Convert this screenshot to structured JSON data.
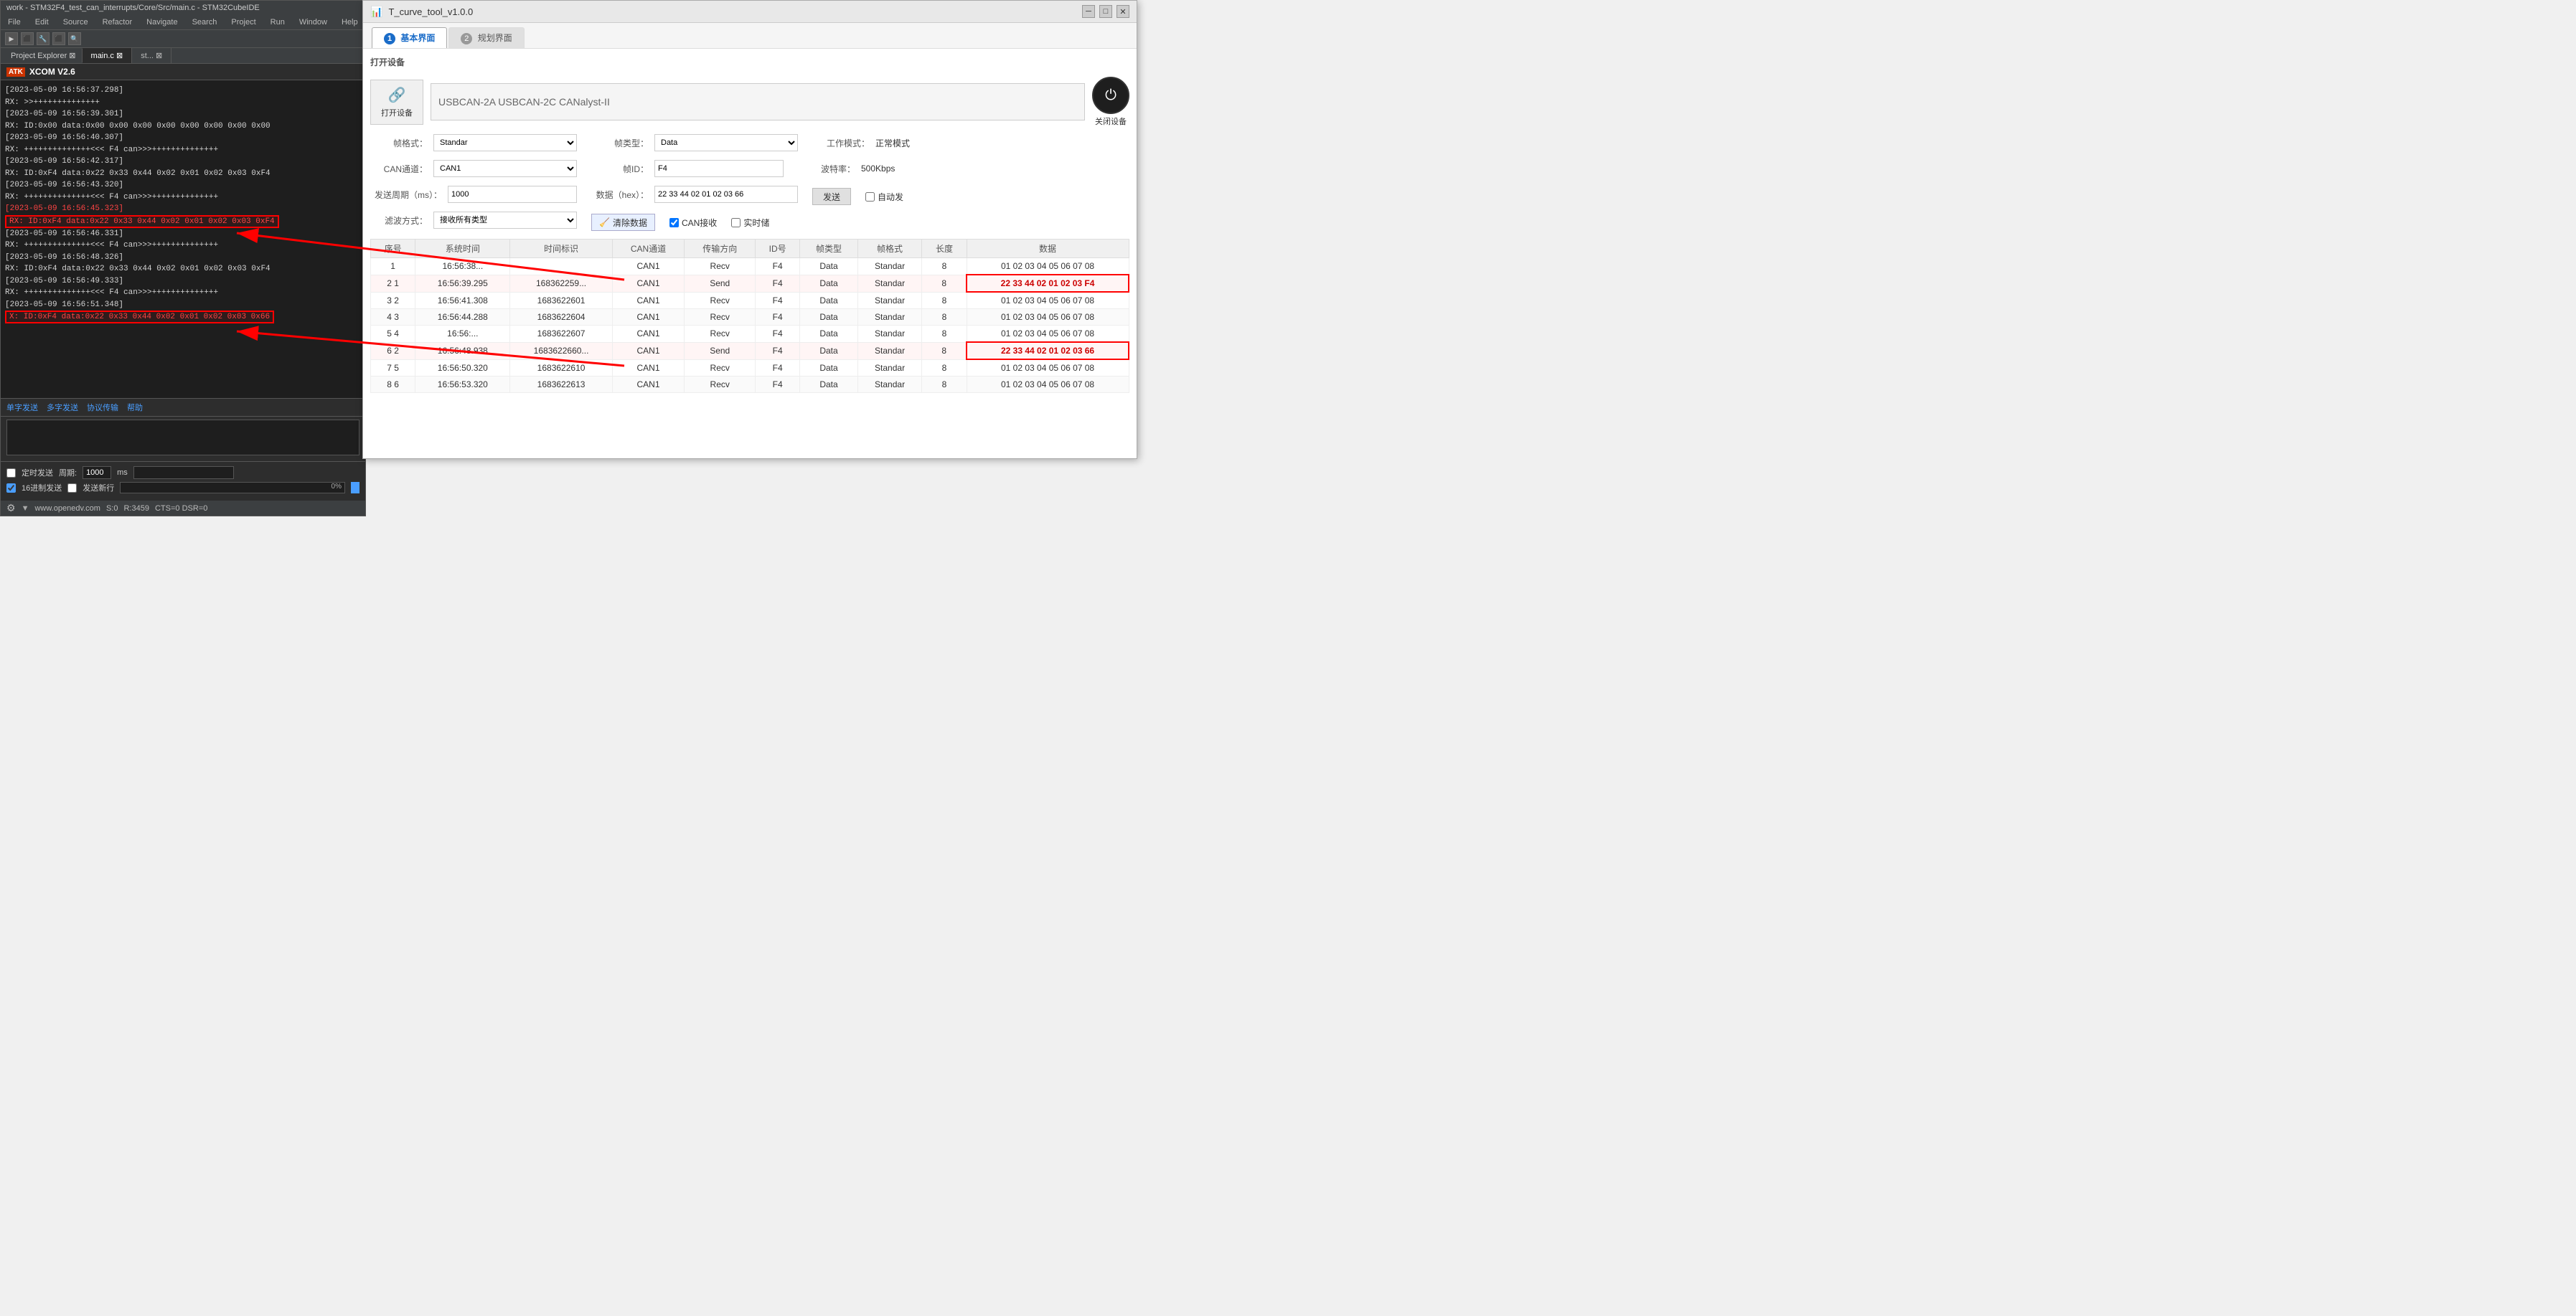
{
  "ide": {
    "title": "work - STM32F4_test_can_interrupts/Core/Src/main.c - STM32CubeIDE",
    "menu": [
      "File",
      "Edit",
      "Source",
      "Refactor",
      "Navigate",
      "Search",
      "Project",
      "Run",
      "Window",
      "Help"
    ],
    "tabs": [
      {
        "label": "main.c",
        "active": true
      },
      {
        "label": "st...",
        "active": false
      }
    ],
    "xcom": {
      "title": "XCOM V2.6",
      "logo": "ATK",
      "logs": [
        {
          "text": "[2023-05-09 16:56:37.298]",
          "type": "timestamp"
        },
        {
          "text": "RX: >>++++++++++++++",
          "type": "normal"
        },
        {
          "text": "[2023-05-09 16:56:39.301]",
          "type": "timestamp"
        },
        {
          "text": "RX: ID:0x00   data:0x00 0x00 0x00 0x00 0x00 0x00 0x00 0x00",
          "type": "normal"
        },
        {
          "text": "[2023-05-09 16:56:40.307]",
          "type": "timestamp"
        },
        {
          "text": "RX: ++++++++++++++<<< F4 can>>>++++++++++++++",
          "type": "normal"
        },
        {
          "text": "[2023-05-09 16:56:42.317]",
          "type": "timestamp"
        },
        {
          "text": "RX: ID:0xF4   data:0x22 0x33 0x44 0x02 0x01 0x02 0x03 0xF4",
          "type": "normal"
        },
        {
          "text": "[2023-05-09 16:56:43.320]",
          "type": "timestamp"
        },
        {
          "text": "RX: ++++++++++++++<<< F4 can>>>++++++++++++++",
          "type": "normal"
        },
        {
          "text": "[2023-05-09 16:56:45.323]",
          "type": "timestamp-red"
        },
        {
          "text": "RX: ID:0xF4   data:0x22 0x33 0x44 0x02 0x01 0x02 0x03 0xF4",
          "type": "highlight"
        },
        {
          "text": "[2023-05-09 16:56:46.331]",
          "type": "timestamp"
        },
        {
          "text": "RX: ++++++++++++++<<< F4 can>>>++++++++++++++",
          "type": "normal"
        },
        {
          "text": "[2023-05-09 16:56:48.326]",
          "type": "timestamp"
        },
        {
          "text": "RX: ID:0xF4   data:0x22 0x33 0x44 0x02 0x01 0x02 0x03 0xF4",
          "type": "normal"
        },
        {
          "text": "[2023-05-09 16:56:49.333]",
          "type": "timestamp"
        },
        {
          "text": "RX: ++++++++++++++<<< F4 can>>>++++++++++++++",
          "type": "normal"
        },
        {
          "text": "[2023-05-09 16:56:51.348]",
          "type": "timestamp"
        },
        {
          "text": "X: ID:0xF4   data:0x22 0x33 0x44 0x02 0x01 0x02 0x03 0x66",
          "type": "highlight2"
        }
      ],
      "bottom_menus": [
        "单字发送",
        "多字发送",
        "协议传输",
        "帮助"
      ],
      "timed_send_label": "定时发送",
      "period_label": "周期:",
      "period_value": "1000",
      "period_unit": "ms",
      "hex_label": "16进制发送",
      "newline_label": "发送新行",
      "progress": "0%",
      "statusbar": {
        "url": "www.openedv.com",
        "s": "S:0",
        "r": "R:3459",
        "cts_dsr": "CTS=0 DSR=0"
      }
    }
  },
  "tcurve": {
    "title": "T_curve_tool_v1.0.0",
    "tabs": [
      {
        "num": "1",
        "label": "基本界面",
        "active": true
      },
      {
        "num": "2",
        "label": "规划界面",
        "active": false
      }
    ],
    "connect_section": {
      "open_device_label": "打开设备",
      "device_options": "USBCAN-2A   USBCAN-2C   CANalyst-II",
      "close_device_label": "关闭设备"
    },
    "form": {
      "frame_format_label": "帧格式：",
      "frame_format_value": "Standar",
      "frame_type_label": "帧类型：",
      "frame_type_value": "Data",
      "work_mode_label": "工作模式：",
      "work_mode_value": "正常模式",
      "can_channel_label": "CAN通道：",
      "can_channel_value": "CAN1",
      "frame_id_label": "帧ID：",
      "frame_id_value": "F4",
      "baud_rate_label": "波特率：",
      "baud_rate_value": "500Kbps",
      "send_period_label": "发送周期（ms）：",
      "send_period_value": "1000",
      "data_hex_label": "数据（hex）：",
      "data_hex_value": "22 33 44 02 01 02 03 66",
      "send_btn_label": "发送",
      "auto_send_label": "□ 自动发",
      "filter_label": "滤波方式：",
      "filter_value": "接收所有类型",
      "clear_data_label": "清除数据",
      "can_recv_label": "☑ CAN接收",
      "realtime_label": "□ 实时储"
    },
    "table": {
      "columns": [
        "序号",
        "系统时间",
        "时间标识",
        "CAN通道",
        "传输方向",
        "ID号",
        "帧类型",
        "帧格式",
        "长度",
        "数据"
      ],
      "rows": [
        {
          "seq": "1",
          "sys_time": "16:56:38...",
          "time_id": "",
          "can_ch": "CAN1",
          "direction": "Recv",
          "id": "F4",
          "frame_type": "Data",
          "frame_format": "Standar",
          "length": "8",
          "data": "01 02 03 04 05 06 07 08",
          "highlight": false,
          "partial_hidden": true
        },
        {
          "seq": "2 1",
          "sys_time": "16:56:39.295",
          "time_id": "168362259...",
          "can_ch": "CAN1",
          "direction": "Send",
          "id": "F4",
          "frame_type": "Data",
          "frame_format": "Standar",
          "length": "8",
          "data": "22 33 44 02 01 02 03 F4",
          "highlight": true,
          "data_highlight": true
        },
        {
          "seq": "3 2",
          "sys_time": "16:56:41.308",
          "time_id": "1683622601",
          "can_ch": "CAN1",
          "direction": "Recv",
          "id": "F4",
          "frame_type": "Data",
          "frame_format": "Standar",
          "length": "8",
          "data": "01 02 03 04 05 06 07 08",
          "highlight": false
        },
        {
          "seq": "4 3",
          "sys_time": "16:56:44.288",
          "time_id": "1683622604",
          "can_ch": "CAN1",
          "direction": "Recv",
          "id": "F4",
          "frame_type": "Data",
          "frame_format": "Standar",
          "length": "8",
          "data": "01 02 03 04 05 06 07 08",
          "highlight": false
        },
        {
          "seq": "5 4",
          "sys_time": "16:56:...",
          "time_id": "1683622607",
          "can_ch": "CAN1",
          "direction": "Recv",
          "id": "F4",
          "frame_type": "Data",
          "frame_format": "Standar",
          "length": "8",
          "data": "01 02 03 04 05 06 07 08",
          "highlight": false,
          "partially_hidden": true
        },
        {
          "seq": "6 2",
          "sys_time": "16:56:48.938",
          "time_id": "1683622660...",
          "can_ch": "CAN1",
          "direction": "Send",
          "id": "F4",
          "frame_type": "Data",
          "frame_format": "Standar",
          "length": "8",
          "data": "22 33 44 02 01 02 03 66",
          "highlight": true,
          "data_highlight": true
        },
        {
          "seq": "7 5",
          "sys_time": "16:56:50.320",
          "time_id": "1683622610",
          "can_ch": "CAN1",
          "direction": "Recv",
          "id": "F4",
          "frame_type": "Data",
          "frame_format": "Standar",
          "length": "8",
          "data": "01 02 03 04 05 06 07 08",
          "highlight": false
        },
        {
          "seq": "8 6",
          "sys_time": "16:56:53.320",
          "time_id": "1683622613",
          "can_ch": "CAN1",
          "direction": "Recv",
          "id": "F4",
          "frame_type": "Data",
          "frame_format": "Standar",
          "length": "8",
          "data": "01 02 03 04 05 06 07 08",
          "highlight": false
        }
      ]
    }
  }
}
